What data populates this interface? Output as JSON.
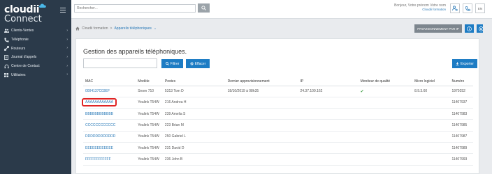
{
  "sidebar": {
    "logo_line1": "cloudii",
    "logo_line2": "Connect",
    "items": [
      {
        "label": "Clients-Ventes",
        "icon": "people-icon"
      },
      {
        "label": "Téléphonie",
        "icon": "phone-icon"
      },
      {
        "label": "Routeurs",
        "icon": "router-icon"
      },
      {
        "label": "Journal d'appels",
        "icon": "call-log-icon"
      },
      {
        "label": "Centre de Contact",
        "icon": "headset-icon"
      },
      {
        "label": "Utilitaires",
        "icon": "grid-icon"
      }
    ]
  },
  "topbar": {
    "search_placeholder": "Rechercher...",
    "greeting": "Bonjour, Votre prénom Votre nom",
    "company": "Cloudii formation",
    "lang": "EN"
  },
  "breadcrumb": {
    "root": "Cloudii formation",
    "separator": ">",
    "current": "Appareils téléphoniques"
  },
  "actions": {
    "provision_all": "PROVISIONNEMENT PAR IP"
  },
  "panel": {
    "title": "Gestion des appareils téléphoniques.",
    "filter_label": "Filtrer",
    "clear_label": "Effacer",
    "export_label": "Exporter"
  },
  "table": {
    "headers": [
      "MAC",
      "Modèle",
      "Postes",
      "Dernier approvisionnement",
      "IP",
      "Moniteur de qualité",
      "Micro logiciel",
      "Numéro"
    ],
    "rows": [
      {
        "mac": "0004137C03EF",
        "model": "Snom 710",
        "post": "5313 Tom D",
        "last": "18/10/2019 à 08h35",
        "ip": "24.37.109.162",
        "quality": true,
        "firmware": "8.9.3.60",
        "number": "1970252"
      },
      {
        "mac": "AAAAAAAAAAAA",
        "model": "Yealink T54W",
        "post": "216 Andrea H",
        "last": "",
        "ip": "",
        "quality": false,
        "firmware": "",
        "number": "11407937"
      },
      {
        "mac": "BBBBBBBBBBBB",
        "model": "Yealink T54W",
        "post": "239 Amelia S",
        "last": "",
        "ip": "",
        "quality": false,
        "firmware": "",
        "number": "11407983"
      },
      {
        "mac": "CCCCCCCCCCCC",
        "model": "Yealink T54W",
        "post": "223 Brian M",
        "last": "",
        "ip": "",
        "quality": false,
        "firmware": "",
        "number": "11407985"
      },
      {
        "mac": "DDDDDDDDDDDD",
        "model": "Yealink T54W",
        "post": "250 Gabriel L",
        "last": "",
        "ip": "",
        "quality": false,
        "firmware": "",
        "number": "11407987"
      },
      {
        "mac": "EEEEEEEEEEEE",
        "model": "Yealink T54W",
        "post": "231 David D",
        "last": "",
        "ip": "",
        "quality": false,
        "firmware": "",
        "number": "11407989"
      },
      {
        "mac": "FFFFFFFFFFFF",
        "model": "Yealink T54W",
        "post": "236 John B",
        "last": "",
        "ip": "",
        "quality": false,
        "firmware": "",
        "number": "11407993"
      }
    ]
  },
  "colors": {
    "sidebar_bg": "#2b3a4a",
    "accent": "#1d7cc4",
    "highlight": "#e02424",
    "check": "#4aa34f"
  }
}
